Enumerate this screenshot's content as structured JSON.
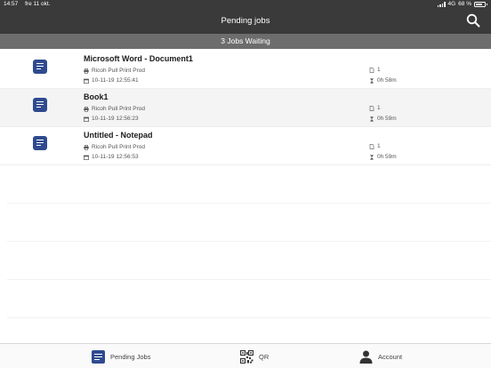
{
  "status_bar": {
    "time": "14:57",
    "date": "fre 11 okt.",
    "network": "4G",
    "battery": "68 %",
    "battery_level": 0.68
  },
  "header": {
    "title": "Pending jobs",
    "search_icon": "search-icon"
  },
  "banner": {
    "text": "3 Jobs Waiting"
  },
  "jobs": [
    {
      "title": "Microsoft Word - Document1",
      "printer": "Ricoh Pull Print Prod",
      "submitted": "10-11-19 12:55:41",
      "copies": "1",
      "expires_in": "0h 58m"
    },
    {
      "title": "Book1",
      "printer": "Ricoh Pull Print Prod",
      "submitted": "10-11-19 12:56:23",
      "copies": "1",
      "expires_in": "0h 59m"
    },
    {
      "title": "Untitled - Notepad",
      "printer": "Ricoh Pull Print Prod",
      "submitted": "10-11-19 12:56:53",
      "copies": "1",
      "expires_in": "0h 59m"
    }
  ],
  "tabs": [
    {
      "label": "Pending Jobs",
      "icon": "document-icon"
    },
    {
      "label": "QR",
      "icon": "qr-code-icon"
    },
    {
      "label": "Account",
      "icon": "person-icon"
    }
  ],
  "colors": {
    "header_bg": "#3a3a3a",
    "banner_bg": "#6d6d6d",
    "accent": "#2f4a8f",
    "alt_row": "#f4f4f4"
  }
}
